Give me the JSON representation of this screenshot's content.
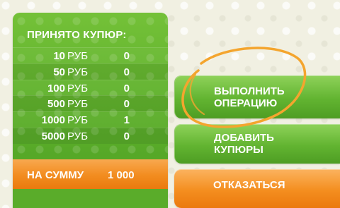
{
  "counter_panel": {
    "title": "ПРИНЯТО КУПЮР:",
    "rows": [
      {
        "denomination": "10",
        "currency": "РУБ",
        "count": "0"
      },
      {
        "denomination": "50",
        "currency": "РУБ",
        "count": "0"
      },
      {
        "denomination": "100",
        "currency": "РУБ",
        "count": "0"
      },
      {
        "denomination": "500",
        "currency": "РУБ",
        "count": "0"
      },
      {
        "denomination": "1000",
        "currency": "РУБ",
        "count": "1"
      },
      {
        "denomination": "5000",
        "currency": "РУБ",
        "count": "0"
      }
    ],
    "sum_label": "НА СУММУ",
    "sum_value": "1 000"
  },
  "buttons": {
    "execute": {
      "line1": "ВЫПОЛНИТЬ",
      "line2": "ОПЕРАЦИЮ"
    },
    "add_bills": {
      "line1": "ДОБАВИТЬ",
      "line2": "КУПЮРЫ"
    },
    "cancel": {
      "label": "ОТКАЗАТЬСЯ"
    }
  },
  "colors": {
    "panel_green": "#5cae2b",
    "button_orange": "#f28c1f",
    "highlight_ring": "#f4a52e",
    "background": "#f1f0e2"
  }
}
